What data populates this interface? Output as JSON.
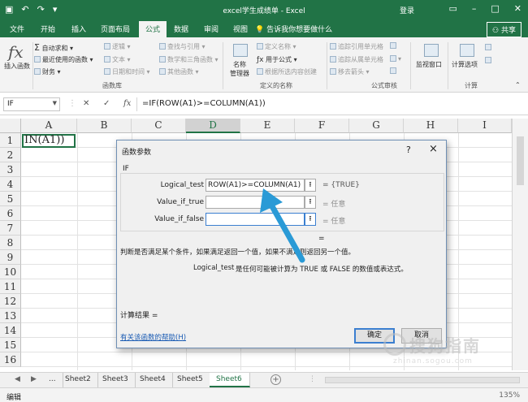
{
  "titlebar": {
    "title": "excel学生成绩单  -  Excel",
    "login": "登录",
    "qa_icons": [
      "save-icon",
      "undo-icon",
      "redo-icon",
      "customize-icon"
    ]
  },
  "tabs": {
    "items": [
      "文件",
      "开始",
      "插入",
      "页面布局",
      "公式",
      "数据",
      "审阅",
      "视图"
    ],
    "active": "公式",
    "tellme": "告诉我你想要做什么",
    "share": "共享"
  },
  "ribbon": {
    "insert_function": "插入函数",
    "autosum": "自动求和",
    "recent": "最近使用的函数",
    "financial": "财务",
    "logical": "逻辑",
    "text": "文本",
    "datetime": "日期和时间",
    "lookup": "查找与引用",
    "math": "数学和三角函数",
    "other": "其他函数",
    "group_library": "函数库",
    "name_manager": "名称\n管理器",
    "define_name": "定义名称",
    "use_in_formula": "用于公式",
    "create_from_sel": "根据所选内容创建",
    "group_names": "定义的名称",
    "trace_precedents": "追踪引用单元格",
    "trace_dependents": "追踪从属单元格",
    "remove_arrows": "移去箭头",
    "group_audit": "公式审核",
    "watch_window": "监视窗口",
    "calc_options": "计算选项",
    "group_calc": "计算"
  },
  "formula_bar": {
    "name_box": "IF",
    "cancel": "✕",
    "enter": "✓",
    "fx": "fx",
    "formula": "=IF(ROW(A1)>=COLUMN(A1))"
  },
  "grid": {
    "columns": [
      "A",
      "B",
      "C",
      "D",
      "E",
      "F",
      "G",
      "H",
      "I"
    ],
    "selected_column": "D",
    "rows": [
      "1",
      "2",
      "3",
      "4",
      "5",
      "6",
      "7",
      "8",
      "9",
      "10",
      "11",
      "12",
      "13",
      "14",
      "15",
      "16"
    ],
    "a1_visible_text": "IN(A1))"
  },
  "dialog": {
    "title": "函数参数",
    "help": "?",
    "close": "×",
    "function_name": "IF",
    "args": [
      {
        "label": "Logical_test",
        "value": "ROW(A1)>=COLUMN(A1)",
        "result": "=  {TRUE}"
      },
      {
        "label": "Value_if_true",
        "value": "",
        "result": "=  任意"
      },
      {
        "label": "Value_if_false",
        "value": "",
        "result": "=  任意"
      }
    ],
    "eq": "=",
    "description": "判断是否满足某个条件，如果满足返回一个值，如果不满足则返回另一个值。",
    "arg_name": "Logical_test",
    "arg_desc": "是任何可能被计算为 TRUE 或 FALSE 的数值或表达式。",
    "result_label": "计算结果 =",
    "help_link": "有关该函数的帮助(H)",
    "ok": "确定",
    "cancel": "取消"
  },
  "sheets": {
    "more": "...",
    "items": [
      "Sheet2",
      "Sheet3",
      "Sheet4",
      "Sheet5",
      "Sheet6"
    ],
    "active": "Sheet6",
    "add": "+"
  },
  "status": {
    "mode": "编辑",
    "zoom": "135%"
  },
  "watermark": {
    "line1": "搜狗指南",
    "line2": "zhinan.sogou.com"
  },
  "colors": {
    "excel_green": "#217346",
    "arrow": "#2a9ad6"
  }
}
